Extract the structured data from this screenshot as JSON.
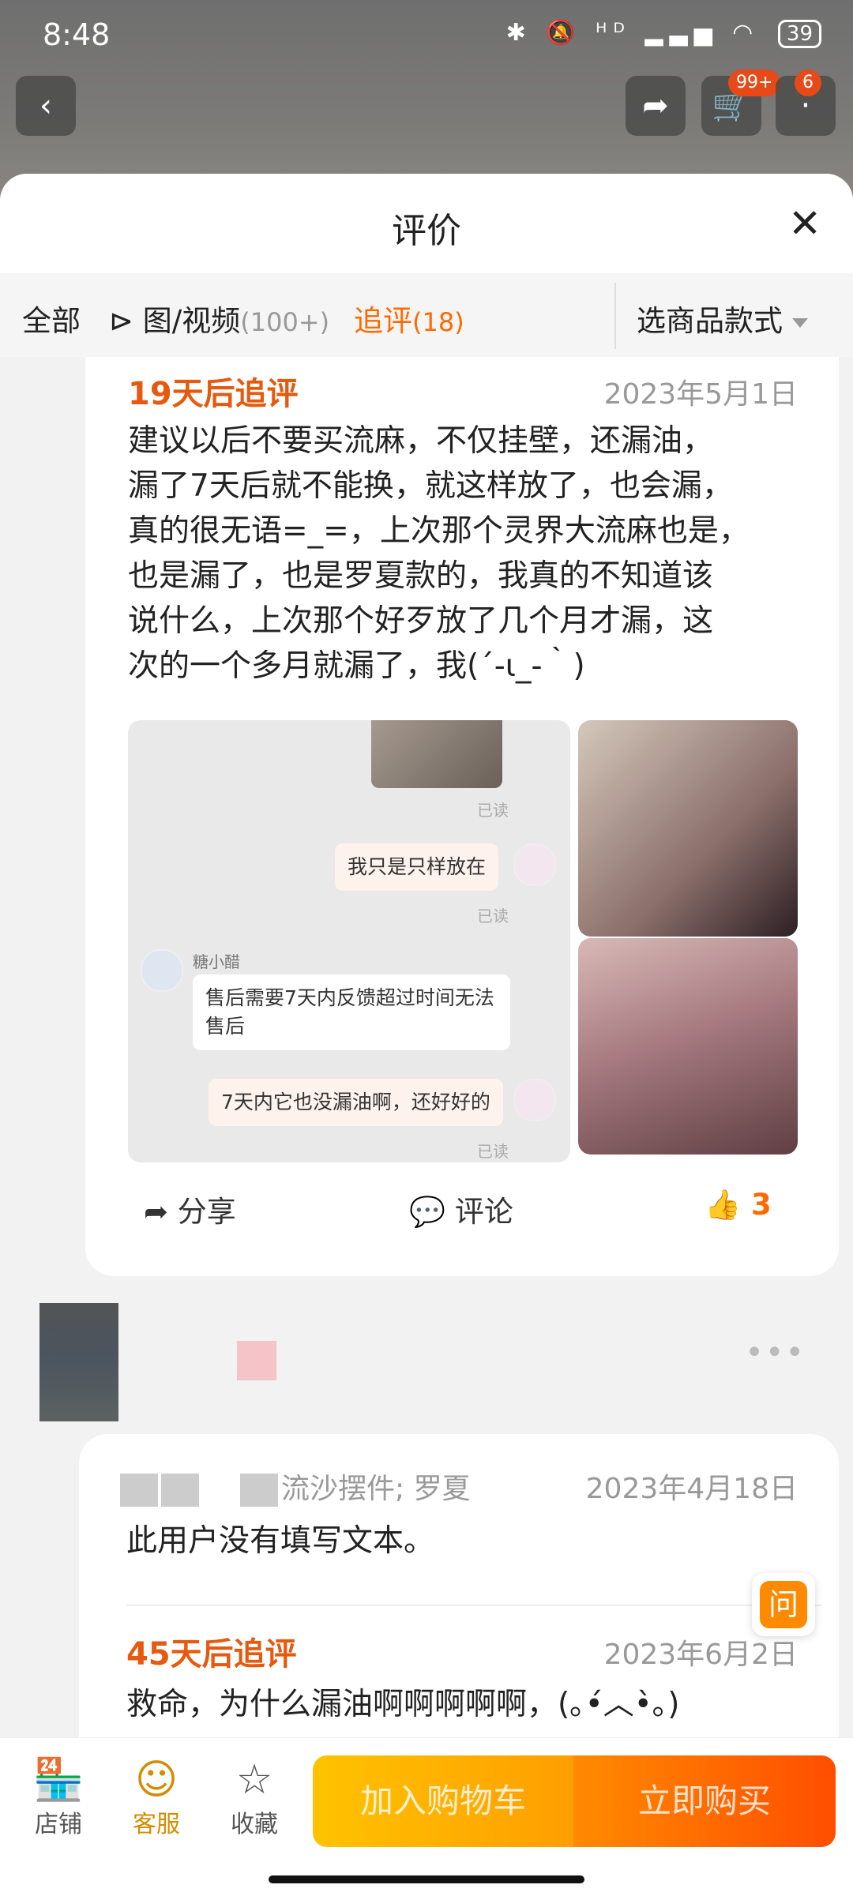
{
  "status": {
    "time": "8:48",
    "icons": "✱ 🔕 ᴴᴰ ▂▃▅ ◠",
    "battery": "39"
  },
  "topbar": {
    "cart_badge": "99+",
    "msg_badge": "6"
  },
  "sheet": {
    "title": "评价"
  },
  "tabs": [
    {
      "label": "全部",
      "count": ""
    },
    {
      "label": "图/视频",
      "count": "(100+)"
    },
    {
      "label": "追评",
      "count": "(18)"
    }
  ],
  "variant_select": "选商品款式",
  "review1": {
    "followup_label": "19天后追评",
    "date": "2023年5月1日",
    "lines": [
      "建议以后不要买流麻，不仅挂壁，还漏油，",
      "漏了7天后就不能换，就这样放了，也会漏，",
      "真的很无语=_=，上次那个灵界大流麻也是，",
      "也是漏了，也是罗夏款的，我真的不知道该",
      "说什么，上次那个好歹放了几个月才漏，这",
      "次的一个多月就漏了，我(´-ι_-｀)"
    ],
    "chat": {
      "read1": "已读",
      "msg1": "我只是只样放在",
      "read2": "已读",
      "agent": "糖小醋",
      "msg2a": "售后需要7天内反馈超过时间无法",
      "msg2b": "售后",
      "msg3": "7天内它也没漏油啊，还好好的",
      "read3": "已读"
    },
    "share": "分享",
    "comment": "评论",
    "likes": "3"
  },
  "review2": {
    "spec": "流沙摆件; 罗夏",
    "date": "2023年4月18日",
    "text": "此用户没有填写文本。",
    "followup_label": "45天后追评",
    "followup_date": "2023年6月2日",
    "followup_text": "救命，为什么漏油啊啊啊啊啊，(｡•́︿•̀｡)"
  },
  "fab": "问",
  "bottom_nav": {
    "shop": "店铺",
    "service": "客服",
    "favorite": "收藏"
  },
  "cta": {
    "cart": "加入购物车",
    "buy": "立即购买"
  }
}
